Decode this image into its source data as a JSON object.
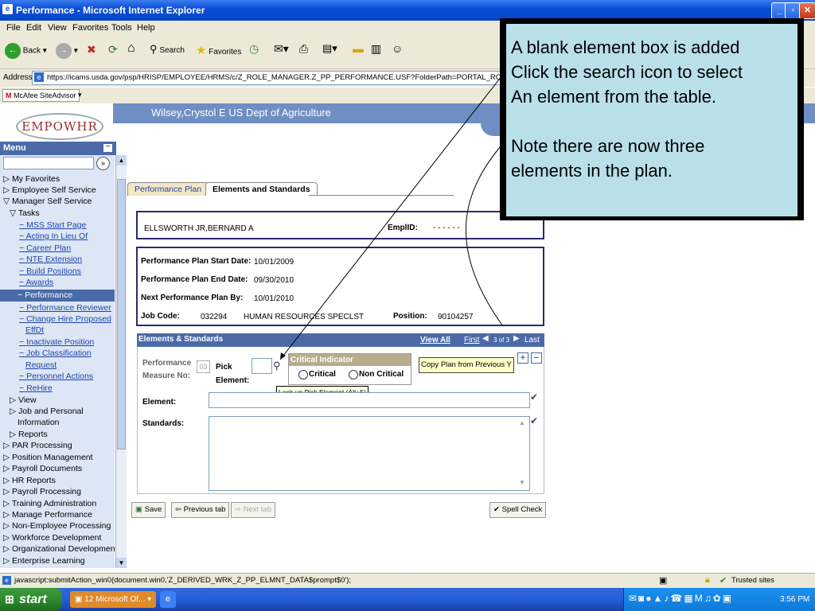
{
  "window": {
    "title": "Performance - Microsoft Internet Explorer"
  },
  "menubar": {
    "items": [
      "File",
      "Edit",
      "View",
      "Favorites",
      "Tools",
      "Help"
    ]
  },
  "toolbar": {
    "back": "Back",
    "search": "Search",
    "favorites": "Favorites"
  },
  "address": {
    "label": "Address",
    "url": "https://icams.usda.gov/psp/HRISP/EMPLOYEE/HRMS/c/Z_ROLE_MANAGER.Z_PP_PERFORMANCE.USF?FolderPath=PORTAL_ROOT_OBJECT.CO_MA"
  },
  "links": {
    "mcafee": "McAfee SiteAdvisor"
  },
  "header": {
    "user": "Wilsey,Crystol E  US Dept of Agriculture",
    "logo": "EMPOWHR"
  },
  "menu": {
    "title": "Menu",
    "items": [
      "My Favorites",
      "Employee Self Service",
      "Manager Self Service",
      "Tasks",
      "MSS Start Page",
      "Acting In Lieu Of",
      "Career Plan",
      "NTE Extension",
      "Build Positions",
      "Awards",
      "Performance",
      "Performance Reviewer",
      "Change Hire Proposed",
      "EffDt",
      "Inactivate Position",
      "Job Classification",
      "Request",
      "Personnel Actions",
      "ReHire",
      "View",
      "Job and Personal",
      "Information",
      "Reports",
      "PAR Processing",
      "Position Management",
      "Payroll Documents",
      "HR Reports",
      "Payroll Processing",
      "Training Administration",
      "Manage Performance",
      "Non-Employee Processing",
      "Workforce Development",
      "Organizational Development",
      "Enterprise Learning"
    ]
  },
  "tabs": {
    "tab1": "Performance Plan",
    "tab2": "Elements and Standards"
  },
  "employee": {
    "name": "ELLSWORTH JR,BERNARD A",
    "emplid_label": "EmplID:",
    "emplid": "- - - - - -"
  },
  "plan": {
    "start_label": "Performance Plan Start Date:",
    "start": "10/01/2009",
    "end_label": "Performance Plan End Date:",
    "end": "09/30/2010",
    "next_label": "Next Performance Plan By:",
    "next": "10/01/2010",
    "jobcode_label": "Job Code:",
    "jobcode": "032294",
    "jobtitle": "HUMAN RESOURCES SPECLST",
    "position_label": "Position:",
    "position": "90104257"
  },
  "elements": {
    "header": "Elements & Standards",
    "view_all": "View All",
    "first": "First",
    "counter": "3 of 3",
    "last": "Last",
    "measure_label_1": "Performance",
    "measure_label_2": "Measure No:",
    "measure_no": "03",
    "pick_label_1": "Pick",
    "pick_label_2": "Element:",
    "tooltip": "Look up Pick Element (Alt+5)",
    "critical_title": "Critical Indicator",
    "critical": "Critical",
    "noncritical": "Non Critical",
    "copy_button": "Copy Plan from Previous Y",
    "element_label": "Element:",
    "standards_label": "Standards:"
  },
  "buttons": {
    "save": "Save",
    "prev_tab": "Previous tab",
    "next_tab": "Next tab",
    "spell": "Spell Check"
  },
  "callout": {
    "line1": "A blank element box is added",
    "line2": "Click the search icon to select",
    "line3": "An element from the table.",
    "line4": "Note there are now three",
    "line5": "elements in the plan."
  },
  "status": {
    "text": "javascript:submitAction_win0(document.win0,'Z_DERIVED_WRK_Z_PP_ELMNT_DATA$prompt$0');",
    "zone": "Trusted sites"
  },
  "taskbar": {
    "start": "start",
    "task": "12 Microsoft Of...",
    "clock": "3:56 PM"
  },
  "colors": {
    "accent": "#4a6aa8",
    "titlebar": "#0a4fd8",
    "callout_bg": "#b9dfe8",
    "start_green": "#2e8b2e"
  }
}
